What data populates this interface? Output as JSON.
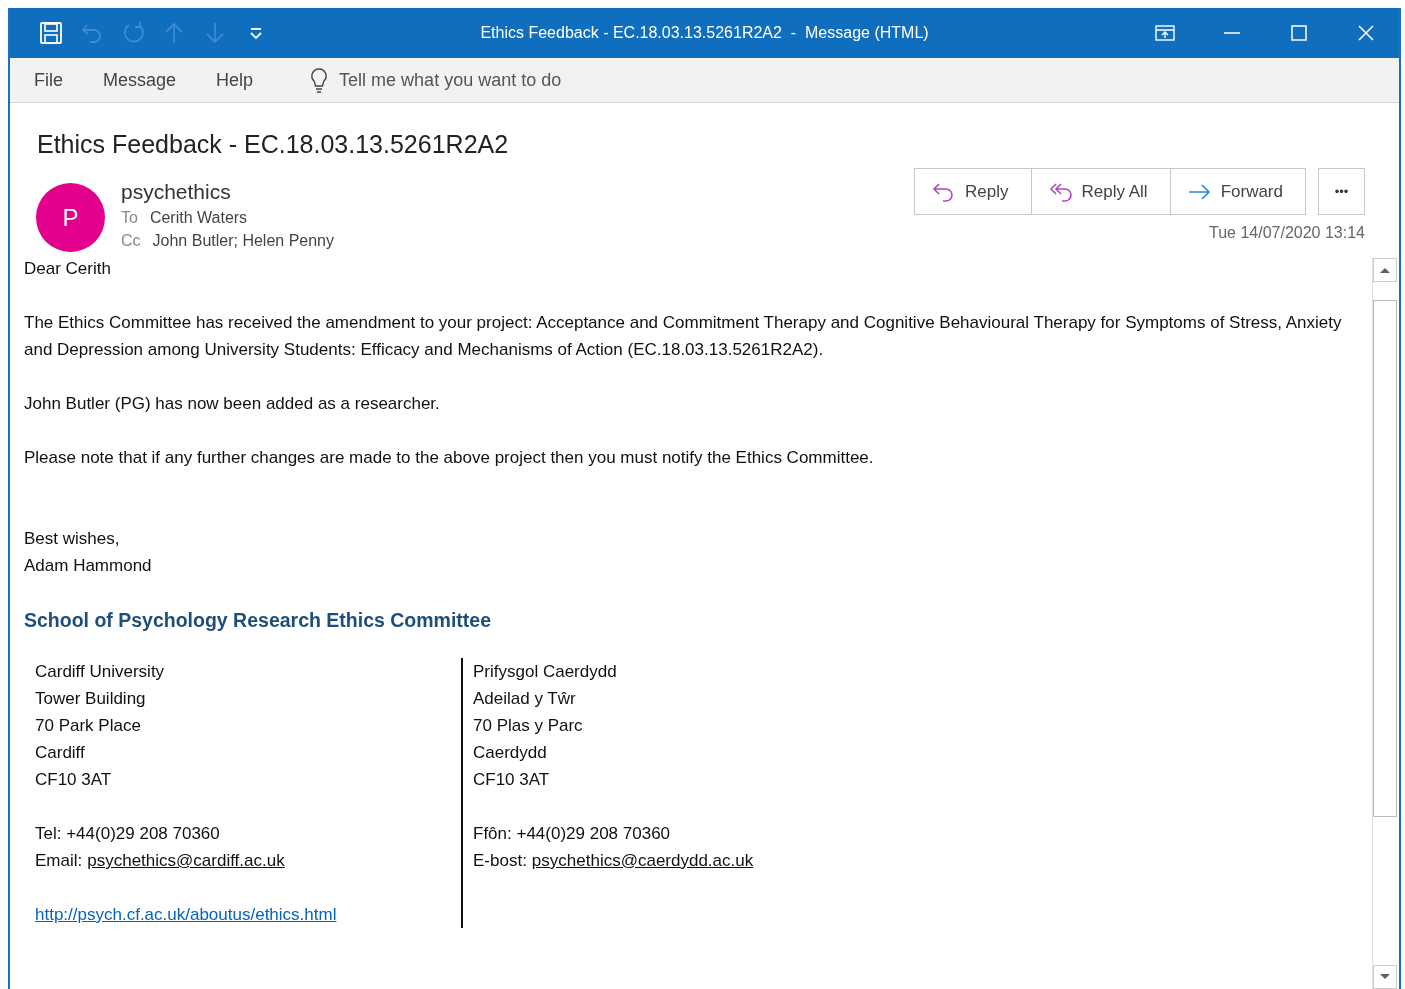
{
  "window": {
    "title": "Ethics Feedback - EC.18.03.13.5261R2A2  -  Message (HTML)",
    "controls": [
      {
        "kind": "ribbon-display"
      },
      {
        "kind": "minimize"
      },
      {
        "kind": "maximize"
      },
      {
        "kind": "close"
      }
    ]
  },
  "quick_access": [
    {
      "kind": "save",
      "disabled": false
    },
    {
      "kind": "undo",
      "disabled": true
    },
    {
      "kind": "redo",
      "disabled": true
    },
    {
      "kind": "up",
      "disabled": true
    },
    {
      "kind": "down",
      "disabled": true
    },
    {
      "kind": "customize",
      "disabled": false
    }
  ],
  "menu": {
    "items": [
      {
        "label": "File"
      },
      {
        "label": "Message"
      },
      {
        "label": "Help"
      }
    ],
    "tell_me": {
      "placeholder": "Tell me what you want to do"
    }
  },
  "message": {
    "subject": "Ethics Feedback - EC.18.03.13.5261R2A2",
    "sender": {
      "initial": "P",
      "name": "psychethics",
      "color": "#e3008c"
    },
    "to_label": "To",
    "to": "Cerith Waters",
    "cc_label": "Cc",
    "cc": "John Butler; Helen Penny",
    "actions": [
      {
        "kind": "reply",
        "label": "Reply"
      },
      {
        "kind": "reply-all",
        "label": "Reply All"
      },
      {
        "kind": "forward",
        "label": "Forward"
      }
    ],
    "more": "•••",
    "date": "Tue 14/07/2020 13:14"
  },
  "body": {
    "paragraphs": [
      "Dear Cerith",
      "The Ethics Committee has received the amendment to your project: Acceptance and Commitment Therapy and Cognitive Behavioural Therapy for Symptoms of Stress, Anxiety and Depression among University Students: Efficacy and Mechanisms of Action (EC.18.03.13.5261R2A2).",
      "John Butler (PG) has now been added as a researcher.",
      "Please note that if any further changes are made to the above project then you must notify the Ethics Committee."
    ],
    "closing": [
      "Best wishes,",
      "Adam Hammond"
    ]
  },
  "signature": {
    "heading": "School of Psychology Research Ethics Committee",
    "columns": [
      {
        "address": [
          "Cardiff University",
          "Tower Building",
          "70 Park Place",
          "Cardiff",
          "CF10 3AT"
        ],
        "contacts": [
          {
            "label": "Tel:",
            "value": "+44(0)29 208 70360",
            "link": false
          },
          {
            "label": "Email:",
            "value": "psychethics@cardiff.ac.uk",
            "link": true
          }
        ],
        "url": "http://psych.cf.ac.uk/aboutus/ethics.html"
      },
      {
        "address": [
          "Prifysgol Caerdydd",
          "Adeilad y Tŵr",
          "70 Plas y Parc",
          "Caerdydd",
          "CF10 3AT"
        ],
        "contacts": [
          {
            "label": "Ffôn:",
            "value": "+44(0)29 208 70360",
            "link": false
          },
          {
            "label": "E-bost:",
            "value": "psychethics@caerdydd.ac.uk",
            "link": true
          }
        ]
      }
    ]
  }
}
